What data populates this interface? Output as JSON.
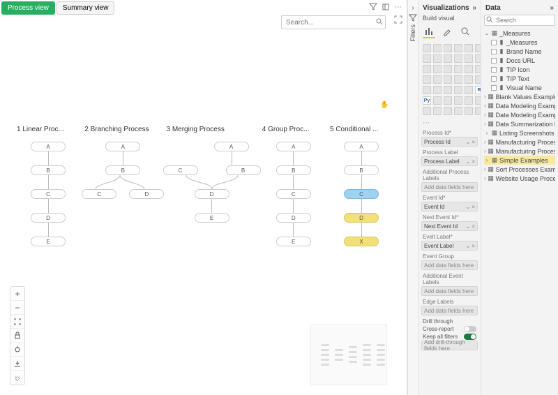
{
  "tabs": {
    "process": "Process view",
    "summary": "Summary view"
  },
  "search": {
    "placeholder": "Search..."
  },
  "processes": {
    "p1": {
      "title": "1 Linear Proc...",
      "nodes": [
        "A",
        "B",
        "C",
        "D",
        "E"
      ]
    },
    "p2": {
      "title": "2 Branching Process",
      "top": [
        "A",
        "B"
      ],
      "branches": [
        "C",
        "D"
      ]
    },
    "p3": {
      "title": "3 Merging Process",
      "upper": [
        "C",
        "B"
      ],
      "lower": [
        "D",
        "E"
      ],
      "topSingle": "A"
    },
    "p4": {
      "title": "4 Group Proc...",
      "nodes": [
        "A",
        "B",
        "C",
        "D",
        "E"
      ]
    },
    "p5": {
      "title": "5 Conditional ...",
      "nodes": [
        "A",
        "B",
        "C",
        "D",
        "X"
      ]
    }
  },
  "filters_label": "Filters",
  "viz": {
    "header": "Visualizations",
    "build": "Build visual",
    "wells": {
      "processId": {
        "title": "Process Id",
        "value": "Process Id"
      },
      "processLabel": {
        "title": "Process Label",
        "value": "Process Label"
      },
      "addlProcess": {
        "title": "Additional Process Labels",
        "placeholder": "Add data fields here"
      },
      "eventId": {
        "title": "Event Id",
        "value": "Event Id"
      },
      "nextEventId": {
        "title": "Next Event Id",
        "value": "Next Event Id"
      },
      "eventLabel": {
        "title": "Evelt Label",
        "value": "Event Label"
      },
      "eventGroup": {
        "title": "Event Group",
        "placeholder": "Add data fields here"
      },
      "addlEvent": {
        "title": "Additional Event Labels",
        "placeholder": "Add data fields here"
      },
      "edgeLabels": {
        "title": "Edge Labels",
        "placeholder": "Add data fields here"
      }
    },
    "drill": {
      "header": "Drill through",
      "cross": "Cross-report",
      "keep": "Keep all filters",
      "placeholder": "Add drill-through fields here"
    }
  },
  "data": {
    "header": "Data",
    "search_placeholder": "Search",
    "measures_table": "_Measures",
    "measures": [
      "_Measures",
      "Brand Name",
      "Docs URL",
      "TIP Icon",
      "TIP Text",
      "Visual Name"
    ],
    "tables": [
      "Blank Values Example",
      "Data Modeling Example - Events",
      "Data Modeling Example - Proces...",
      "Data Summarization Example",
      "Listing Screenshots",
      "Manufacturing Process",
      "Manufacturing Process Header",
      "Simple Examples",
      "Sort Processes Example",
      "Website Usage Process"
    ]
  }
}
